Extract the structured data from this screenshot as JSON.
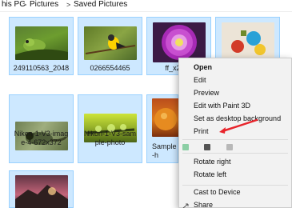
{
  "breadcrumb": {
    "items": [
      "his PC",
      "Pictures",
      "Saved Pictures"
    ],
    "separator": ">"
  },
  "files": [
    {
      "label": "249110563_2048",
      "thumb": "frog-on-leaf"
    },
    {
      "label": "0266554465",
      "thumb": "bird-on-branch"
    },
    {
      "label": "ff_x2048",
      "thumb": "purple-flower"
    },
    {
      "label": "",
      "thumb": "toy-figures"
    },
    {
      "label": "Nikon-1-V3-imag\ne-4-672x372",
      "thumb": "lizard-macro"
    },
    {
      "label": "Nikon-1-V3-sam\nple-photo",
      "thumb": "waterdrops"
    },
    {
      "label": "Sample\n-h",
      "thumb": "orange-fruit"
    },
    {
      "label": "",
      "thumb": "sunset-landscape"
    }
  ],
  "context_menu": {
    "items": [
      "Open",
      "Edit",
      "Preview",
      "Edit with Paint 3D",
      "Set as desktop background",
      "Print",
      "Rotate right",
      "Rotate left",
      "Cast to Device",
      "Share"
    ]
  },
  "colors": {
    "selection_fill": "#cde8ff",
    "selection_border": "#99d1ff",
    "menu_background": "#f2f2f2",
    "annotation_arrow": "#e8242b"
  }
}
